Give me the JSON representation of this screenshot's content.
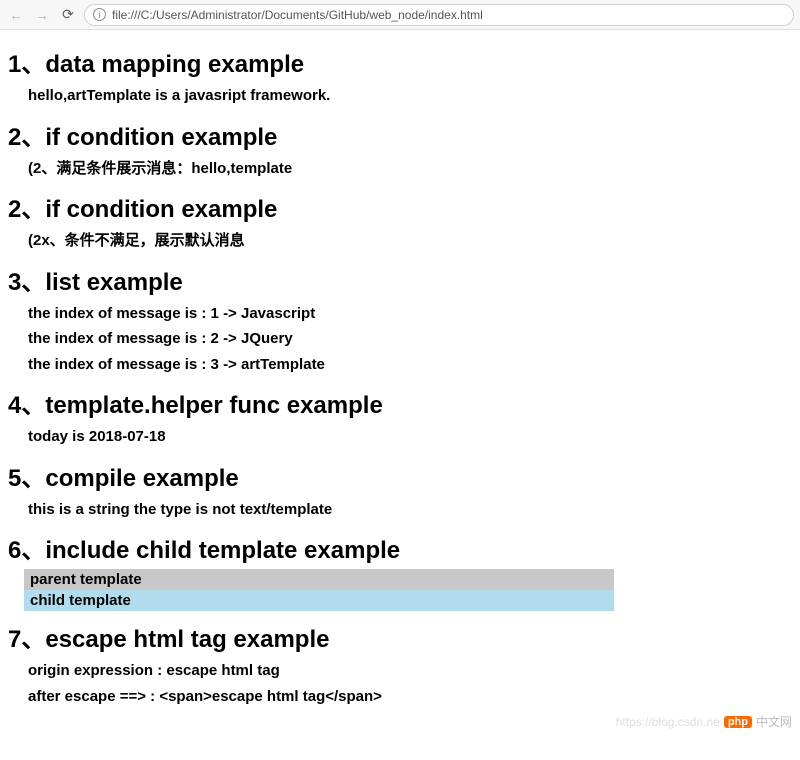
{
  "browser": {
    "url": "file:///C:/Users/Administrator/Documents/GitHub/web_node/index.html"
  },
  "sections": {
    "s1": {
      "title": "1、data mapping example",
      "line1": "hello,artTemplate is a javasript framework."
    },
    "s2a": {
      "title": "2、if condition example",
      "line1": "(2、满足条件展示消息：hello,template"
    },
    "s2b": {
      "title": "2、if condition example",
      "line1": "(2x、条件不满足，展示默认消息"
    },
    "s3": {
      "title": "3、list example",
      "line1": "the index of message is : 1 -> Javascript",
      "line2": "the index of message is : 2 -> JQuery",
      "line3": "the index of message is : 3 -> artTemplate"
    },
    "s4": {
      "title": "4、template.helper func example",
      "line1": "today is 2018-07-18"
    },
    "s5": {
      "title": "5、compile example",
      "line1": "this is a string the type is not text/template"
    },
    "s6": {
      "title": "6、include child template example",
      "parent": "parent template",
      "child": "child template"
    },
    "s7": {
      "title": "7、escape html tag example",
      "line1": "origin expression : escape html tag",
      "line2": "after escape ==> : <span>escape html tag</span>"
    }
  },
  "watermark": {
    "url": "https://blog.csdn.ne",
    "badge": "php",
    "cn": "中文网"
  }
}
